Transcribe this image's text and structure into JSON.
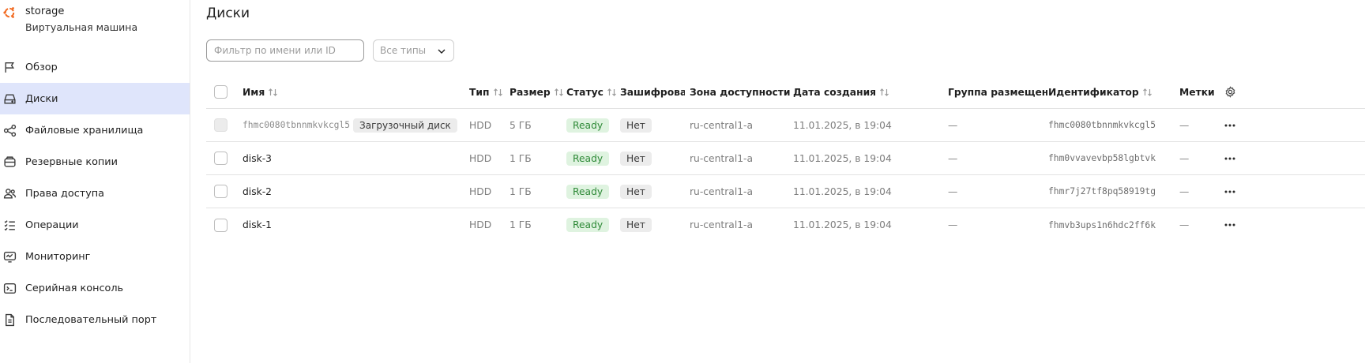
{
  "vm": {
    "name": "storage",
    "type": "Виртуальная машина"
  },
  "sidebar": {
    "items": [
      {
        "label": "Обзор",
        "icon": "flag-icon",
        "active": false
      },
      {
        "label": "Диски",
        "icon": "disk-icon",
        "active": true
      },
      {
        "label": "Файловые хранилища",
        "icon": "share-icon",
        "active": false
      },
      {
        "label": "Резервные копии",
        "icon": "backup-icon",
        "active": false
      },
      {
        "label": "Права доступа",
        "icon": "users-icon",
        "active": false
      },
      {
        "label": "Операции",
        "icon": "list-icon",
        "active": false
      },
      {
        "label": "Мониторинг",
        "icon": "monitor-icon",
        "active": false
      },
      {
        "label": "Серийная консоль",
        "icon": "terminal-icon",
        "active": false
      },
      {
        "label": "Последовательный порт",
        "icon": "file-icon",
        "active": false
      }
    ]
  },
  "page": {
    "title": "Диски"
  },
  "filter": {
    "placeholder": "Фильтр по имени или ID",
    "value": ""
  },
  "type_select": {
    "value": "Все типы"
  },
  "table": {
    "columns": {
      "name": "Имя",
      "type": "Тип",
      "size": "Размер",
      "status": "Статус",
      "encrypted": "Зашифрован",
      "zone": "Зона доступности",
      "created": "Дата создания",
      "group": "Группа размещения",
      "id": "Идентификатор",
      "tags": "Метки"
    },
    "rows": [
      {
        "name": "fhmc0080tbnnmkvkcgl5",
        "boot_label": "Загрузочный диск",
        "type": "HDD",
        "size": "5 ГБ",
        "status": "Ready",
        "encrypted": "Нет",
        "zone": "ru-central1-a",
        "created": "11.01.2025, в 19:04",
        "group": "—",
        "id": "fhmc0080tbnnmkvkcgl5",
        "tags": "—"
      },
      {
        "name": "disk-3",
        "type": "HDD",
        "size": "1 ГБ",
        "status": "Ready",
        "encrypted": "Нет",
        "zone": "ru-central1-a",
        "created": "11.01.2025, в 19:04",
        "group": "—",
        "id": "fhm0vvavevbp58lgbtvk",
        "tags": "—"
      },
      {
        "name": "disk-2",
        "type": "HDD",
        "size": "1 ГБ",
        "status": "Ready",
        "encrypted": "Нет",
        "zone": "ru-central1-a",
        "created": "11.01.2025, в 19:04",
        "group": "—",
        "id": "fhmr7j27tf8pq58919tg",
        "tags": "—"
      },
      {
        "name": "disk-1",
        "type": "HDD",
        "size": "1 ГБ",
        "status": "Ready",
        "encrypted": "Нет",
        "zone": "ru-central1-a",
        "created": "11.01.2025, в 19:04",
        "group": "—",
        "id": "fhmvb3ups1n6hdc2ff6k",
        "tags": "—"
      }
    ]
  },
  "colors": {
    "accent": "#dfe5fb",
    "ready_bg": "#dff3e0",
    "ready_text": "#2f8a38",
    "brand": "#f26b22"
  }
}
